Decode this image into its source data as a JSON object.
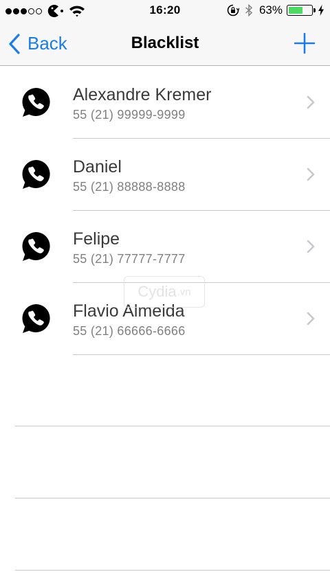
{
  "status_bar": {
    "signal_dots_filled": 3,
    "signal_dots_total": 5,
    "carrier_icon": "pacman-carrier-icon",
    "time": "16:20",
    "battery_percent": "63%",
    "battery_level": 0.63,
    "battery_color": "#4cd964"
  },
  "nav": {
    "back_label": "Back",
    "title": "Blacklist",
    "accent_color": "#1a7ce4"
  },
  "contacts": [
    {
      "name": "Alexandre Kremer",
      "phone": "55 (21) 99999-9999",
      "icon": "whatsapp-icon"
    },
    {
      "name": "Daniel",
      "phone": "55 (21) 88888-8888",
      "icon": "whatsapp-icon"
    },
    {
      "name": "Felipe",
      "phone": "55 (21) 77777-7777",
      "icon": "whatsapp-icon"
    },
    {
      "name": "Flavio Almeida",
      "phone": "55 (21) 66666-6666",
      "icon": "whatsapp-icon"
    }
  ],
  "watermark": {
    "text": "Cydia",
    "tld": ".vn"
  }
}
